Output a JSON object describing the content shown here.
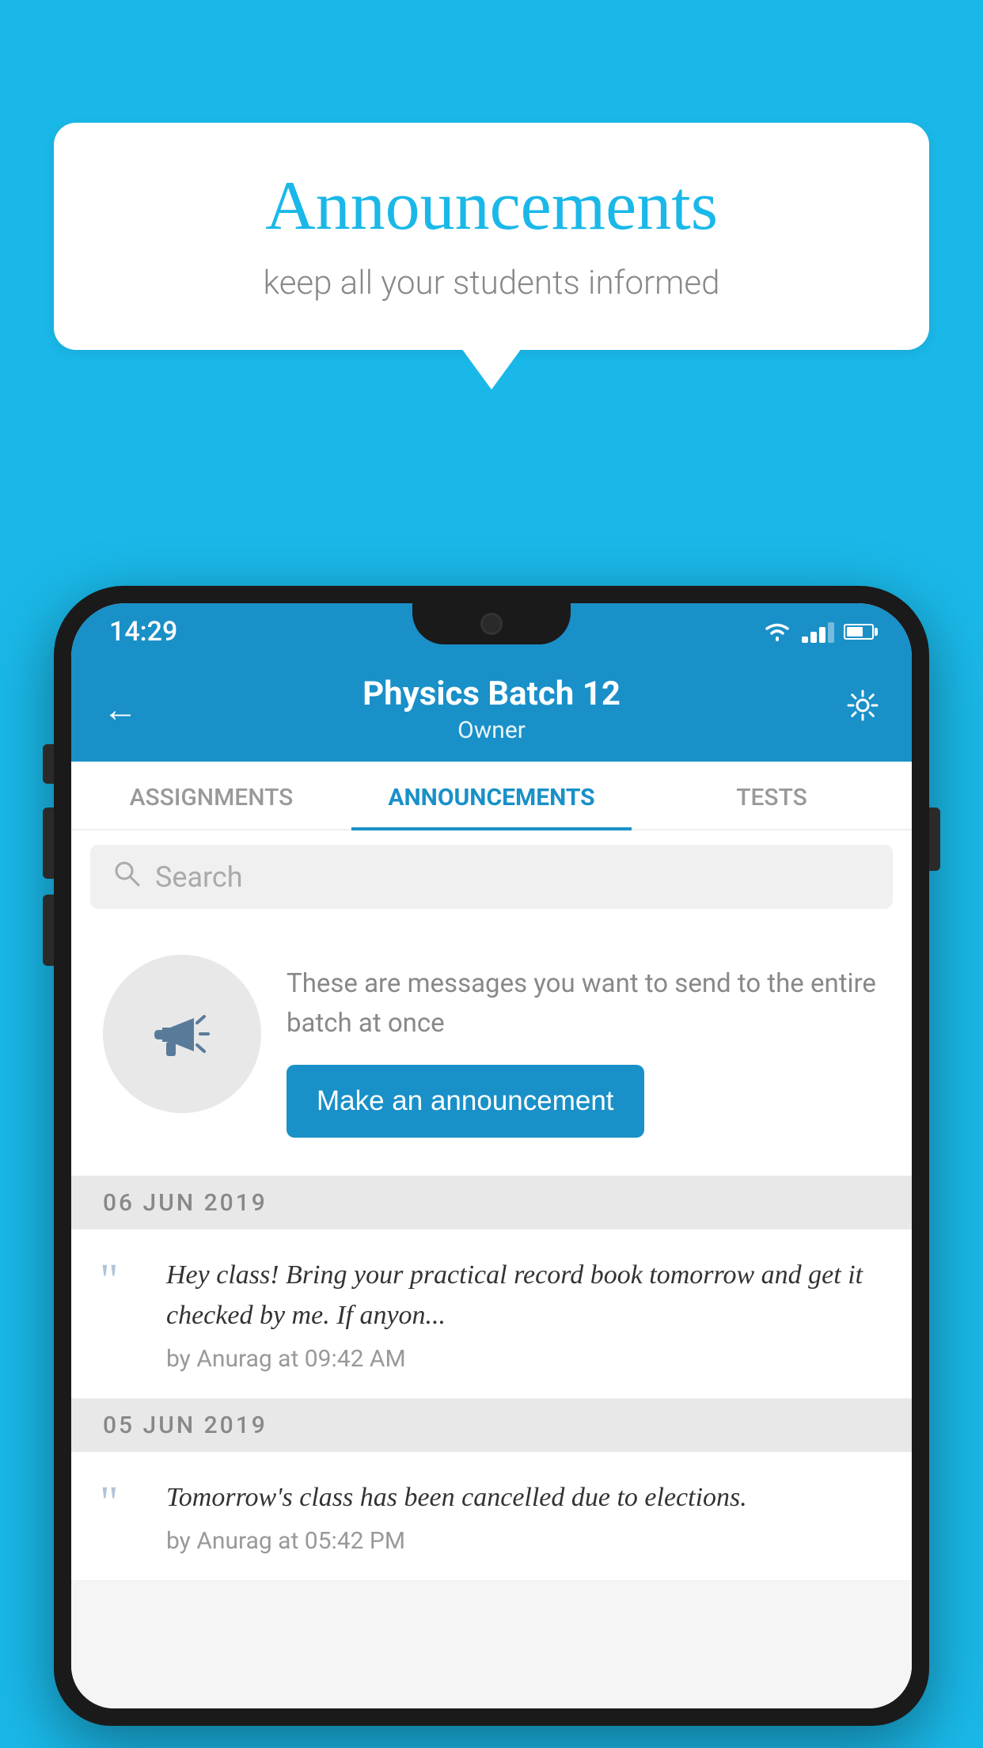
{
  "background_color": "#1ab8e8",
  "speech_bubble": {
    "title": "Announcements",
    "subtitle": "keep all your students informed"
  },
  "phone": {
    "status_bar": {
      "time": "14:29"
    },
    "header": {
      "title": "Physics Batch 12",
      "subtitle": "Owner",
      "back_label": "←",
      "settings_label": "⚙"
    },
    "tabs": [
      {
        "label": "ASSIGNMENTS",
        "active": false
      },
      {
        "label": "ANNOUNCEMENTS",
        "active": true
      },
      {
        "label": "TESTS",
        "active": false
      }
    ],
    "search": {
      "placeholder": "Search"
    },
    "promo": {
      "description": "These are messages you want to send to the entire batch at once",
      "button_label": "Make an announcement"
    },
    "announcements": [
      {
        "date": "06  JUN  2019",
        "text": "Hey class! Bring your practical record book tomorrow and get it checked by me. If anyon...",
        "meta": "by Anurag at 09:42 AM"
      },
      {
        "date": "05  JUN  2019",
        "text": "Tomorrow's class has been cancelled due to elections.",
        "meta": "by Anurag at 05:42 PM"
      }
    ]
  }
}
